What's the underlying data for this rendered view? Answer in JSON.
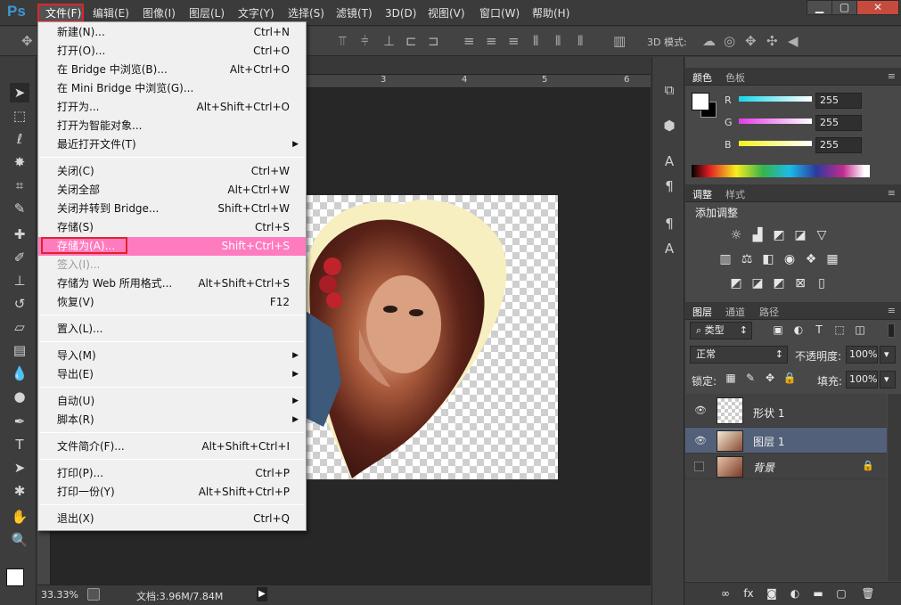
{
  "app_logo": "Ps",
  "menubar": [
    "文件(F)",
    "编辑(E)",
    "图像(I)",
    "图层(L)",
    "文字(Y)",
    "选择(S)",
    "滤镜(T)",
    "3D(D)",
    "视图(V)",
    "窗口(W)",
    "帮助(H)"
  ],
  "window_controls": {
    "minimize": "▁",
    "restore": "▢",
    "close": "✕"
  },
  "options_bar": {
    "label_3d": "3D 模式:"
  },
  "ruler_ticks": [
    "3",
    "4",
    "5",
    "6"
  ],
  "status": {
    "zoom": "33.33%",
    "doc": "文档:3.96M/7.84M"
  },
  "file_menu": [
    {
      "label": "新建(N)...",
      "shortcut": "Ctrl+N"
    },
    {
      "label": "打开(O)...",
      "shortcut": "Ctrl+O"
    },
    {
      "label": "在 Bridge 中浏览(B)...",
      "shortcut": "Alt+Ctrl+O"
    },
    {
      "label": "在 Mini Bridge 中浏览(G)...",
      "shortcut": ""
    },
    {
      "label": "打开为...",
      "shortcut": "Alt+Shift+Ctrl+O"
    },
    {
      "label": "打开为智能对象...",
      "shortcut": ""
    },
    {
      "label": "最近打开文件(T)",
      "shortcut": "",
      "submenu": true
    },
    {
      "sep": true
    },
    {
      "label": "关闭(C)",
      "shortcut": "Ctrl+W"
    },
    {
      "label": "关闭全部",
      "shortcut": "Alt+Ctrl+W"
    },
    {
      "label": "关闭并转到 Bridge...",
      "shortcut": "Shift+Ctrl+W"
    },
    {
      "label": "存储(S)",
      "shortcut": "Ctrl+S"
    },
    {
      "label": "存储为(A)...",
      "shortcut": "Shift+Ctrl+S",
      "highlight": true
    },
    {
      "label": "签入(I)...",
      "shortcut": "",
      "disabled": true
    },
    {
      "label": "存储为 Web 所用格式...",
      "shortcut": "Alt+Shift+Ctrl+S"
    },
    {
      "label": "恢复(V)",
      "shortcut": "F12"
    },
    {
      "sep": true
    },
    {
      "label": "置入(L)...",
      "shortcut": ""
    },
    {
      "sep": true
    },
    {
      "label": "导入(M)",
      "shortcut": "",
      "submenu": true
    },
    {
      "label": "导出(E)",
      "shortcut": "",
      "submenu": true
    },
    {
      "sep": true
    },
    {
      "label": "自动(U)",
      "shortcut": "",
      "submenu": true
    },
    {
      "label": "脚本(R)",
      "shortcut": "",
      "submenu": true
    },
    {
      "sep": true
    },
    {
      "label": "文件简介(F)...",
      "shortcut": "Alt+Shift+Ctrl+I"
    },
    {
      "sep": true
    },
    {
      "label": "打印(P)...",
      "shortcut": "Ctrl+P"
    },
    {
      "label": "打印一份(Y)",
      "shortcut": "Alt+Shift+Ctrl+P"
    },
    {
      "sep": true
    },
    {
      "label": "退出(X)",
      "shortcut": "Ctrl+Q"
    }
  ],
  "color_panel": {
    "tabs": [
      "颜色",
      "色板"
    ],
    "channels": [
      {
        "name": "R",
        "value": "255"
      },
      {
        "name": "G",
        "value": "255"
      },
      {
        "name": "B",
        "value": "255"
      }
    ]
  },
  "adjust_panel": {
    "tabs": [
      "调整",
      "样式"
    ],
    "title": "添加调整"
  },
  "layers_panel": {
    "tabs": [
      "图层",
      "通道",
      "路径"
    ],
    "filter": "类型",
    "blend": "正常",
    "opacity_label": "不透明度:",
    "opacity": "100%",
    "lock_label": "锁定:",
    "fill_label": "填充:",
    "fill": "100%",
    "layers": [
      {
        "name": "形状 1"
      },
      {
        "name": "图层 1",
        "selected": true
      },
      {
        "name": "背景",
        "locked": true
      }
    ]
  },
  "colors": {
    "highlight": "#ff7bbf",
    "annotation": "#e0242b",
    "selected_layer": "#526179"
  }
}
